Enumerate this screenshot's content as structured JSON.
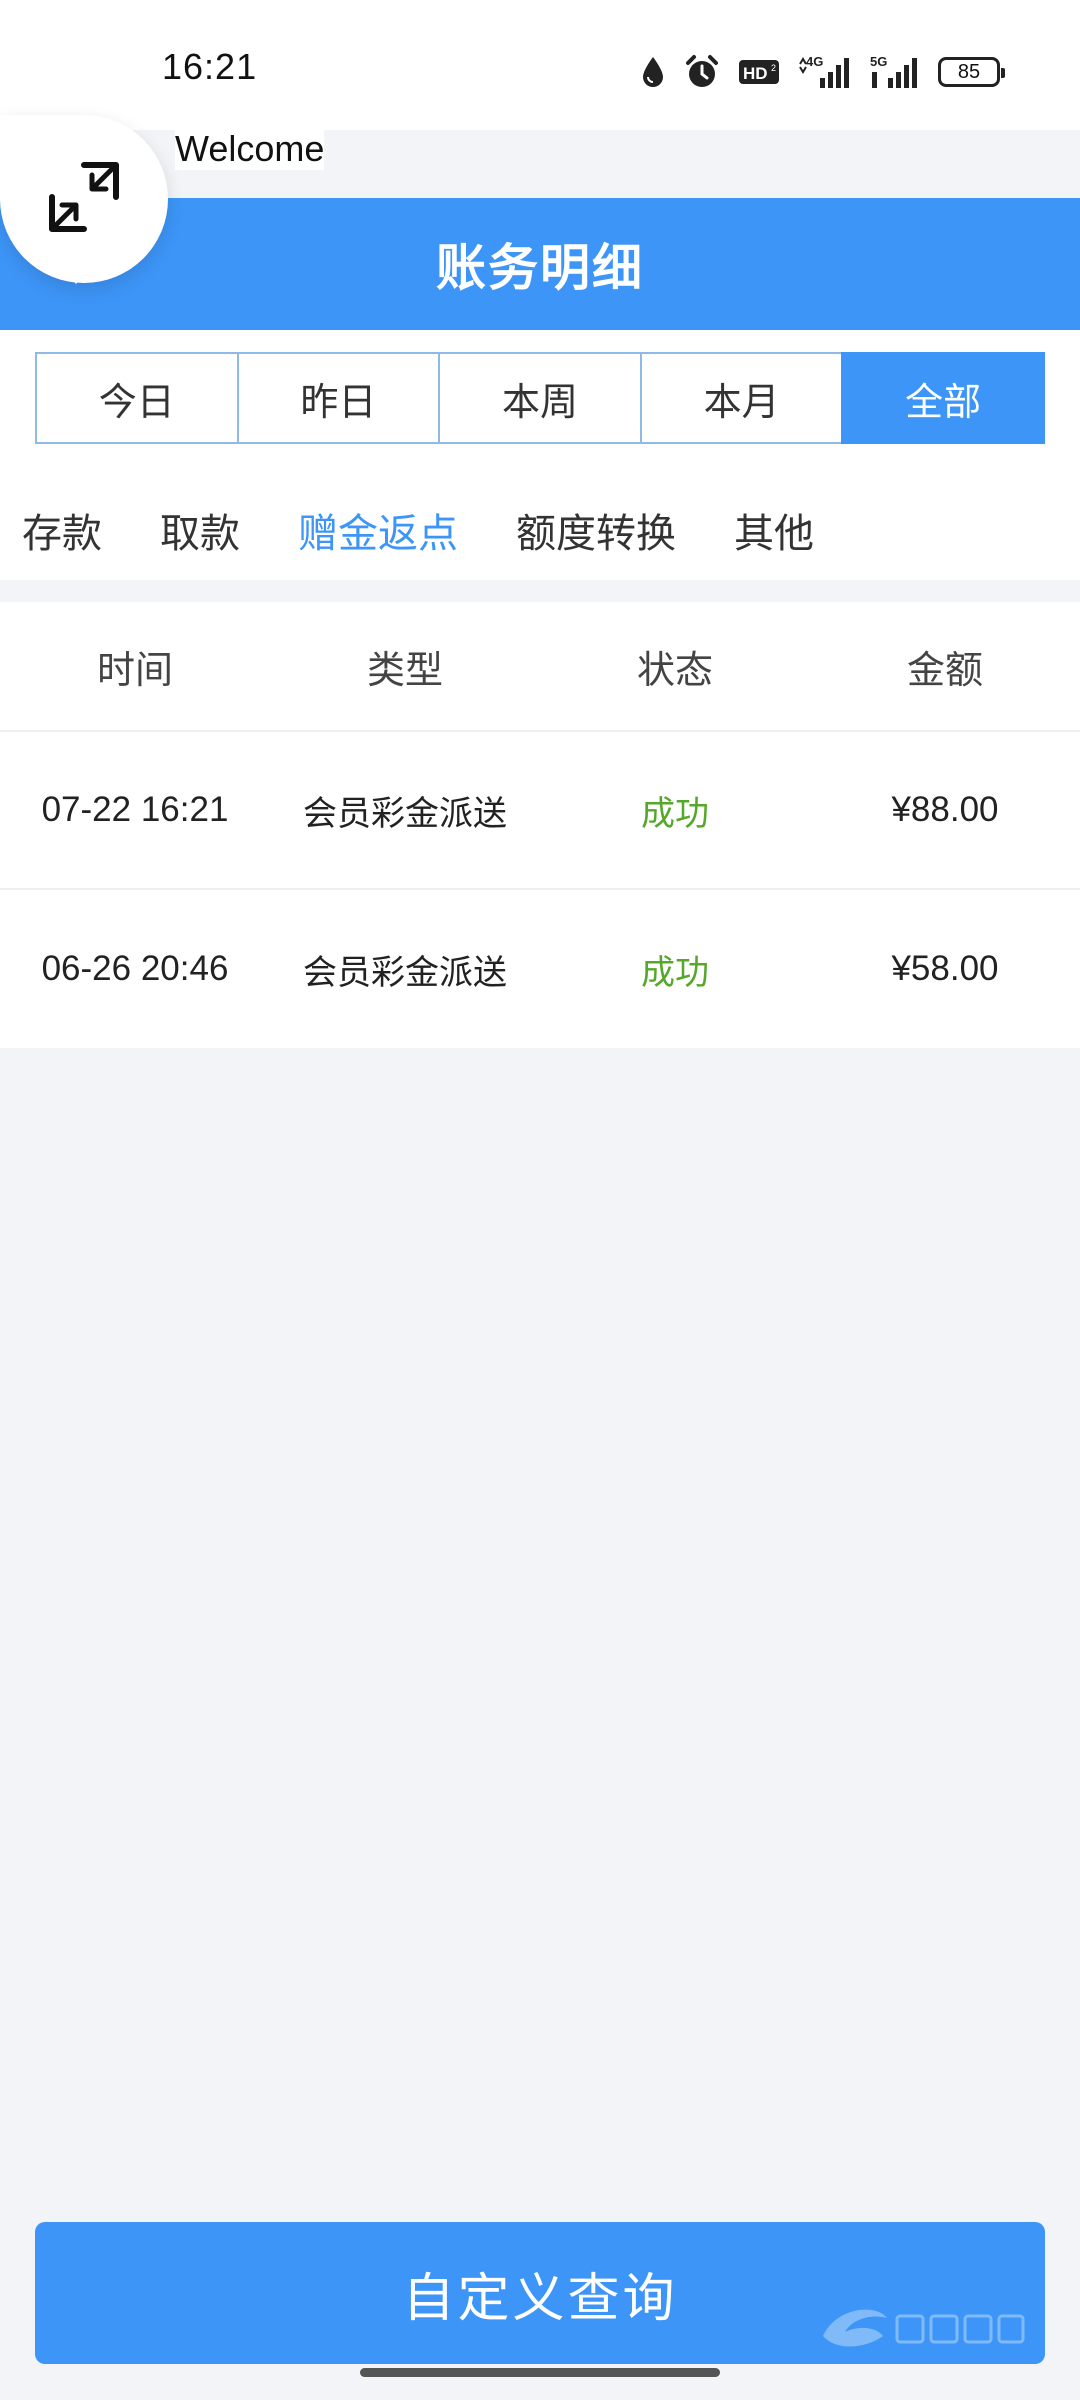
{
  "status_bar": {
    "time": "16:21",
    "battery": "85",
    "icons": [
      "water-drop-icon",
      "alarm-icon",
      "hd-icon",
      "signal-4g-icon",
      "signal-5g-icon",
      "battery-icon"
    ]
  },
  "floating": {
    "welcome": "Welcome",
    "icon": "collapse-arrows-icon"
  },
  "header": {
    "title": "账务明细"
  },
  "date_tabs": [
    {
      "label": "今日",
      "active": false
    },
    {
      "label": "昨日",
      "active": false
    },
    {
      "label": "本周",
      "active": false
    },
    {
      "label": "本月",
      "active": false
    },
    {
      "label": "全部",
      "active": true
    }
  ],
  "type_tabs": [
    {
      "label": "存款",
      "active": false
    },
    {
      "label": "取款",
      "active": false
    },
    {
      "label": "赠金返点",
      "active": true
    },
    {
      "label": "额度转换",
      "active": false
    },
    {
      "label": "其他",
      "active": false
    }
  ],
  "table": {
    "headers": [
      "时间",
      "类型",
      "状态",
      "金额"
    ],
    "rows": [
      {
        "time": "07-22 16:21",
        "type": "会员彩金派送",
        "status": "成功",
        "amount": "¥88.00"
      },
      {
        "time": "06-26 20:46",
        "type": "会员彩金派送",
        "status": "成功",
        "amount": "¥58.00"
      }
    ]
  },
  "query_button": {
    "label": "自定义查询"
  },
  "colors": {
    "primary": "#3d95f7",
    "success": "#55a82a",
    "background": "#f2f4f7"
  }
}
